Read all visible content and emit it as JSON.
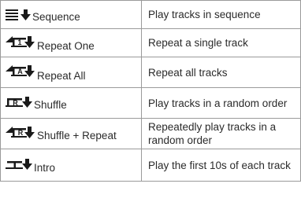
{
  "playback_modes": [
    {
      "icon": "sequence-icon",
      "label": "Sequence",
      "description": "Play tracks in sequence"
    },
    {
      "icon": "repeat-one-icon",
      "label": "Repeat One",
      "description": "Repeat a single track"
    },
    {
      "icon": "repeat-all-icon",
      "label": "Repeat All",
      "description": "Repeat all tracks"
    },
    {
      "icon": "shuffle-icon",
      "label": "Shuffle",
      "description": "Play tracks in a random order"
    },
    {
      "icon": "shuffle-repeat-icon",
      "label": "Shuffle + Repeat",
      "description": "Repeatedly play tracks in a random order"
    },
    {
      "icon": "intro-icon",
      "label": "Intro",
      "description": "Play the first 10s of each track"
    }
  ],
  "icon_letters": {
    "repeat_one": "1",
    "repeat_all": "A",
    "shuffle": "R",
    "shuffle_repeat": "R"
  },
  "colors": {
    "text": "#2b2b2b",
    "border": "#9a9a9a",
    "icon": "#1a1a1a"
  }
}
